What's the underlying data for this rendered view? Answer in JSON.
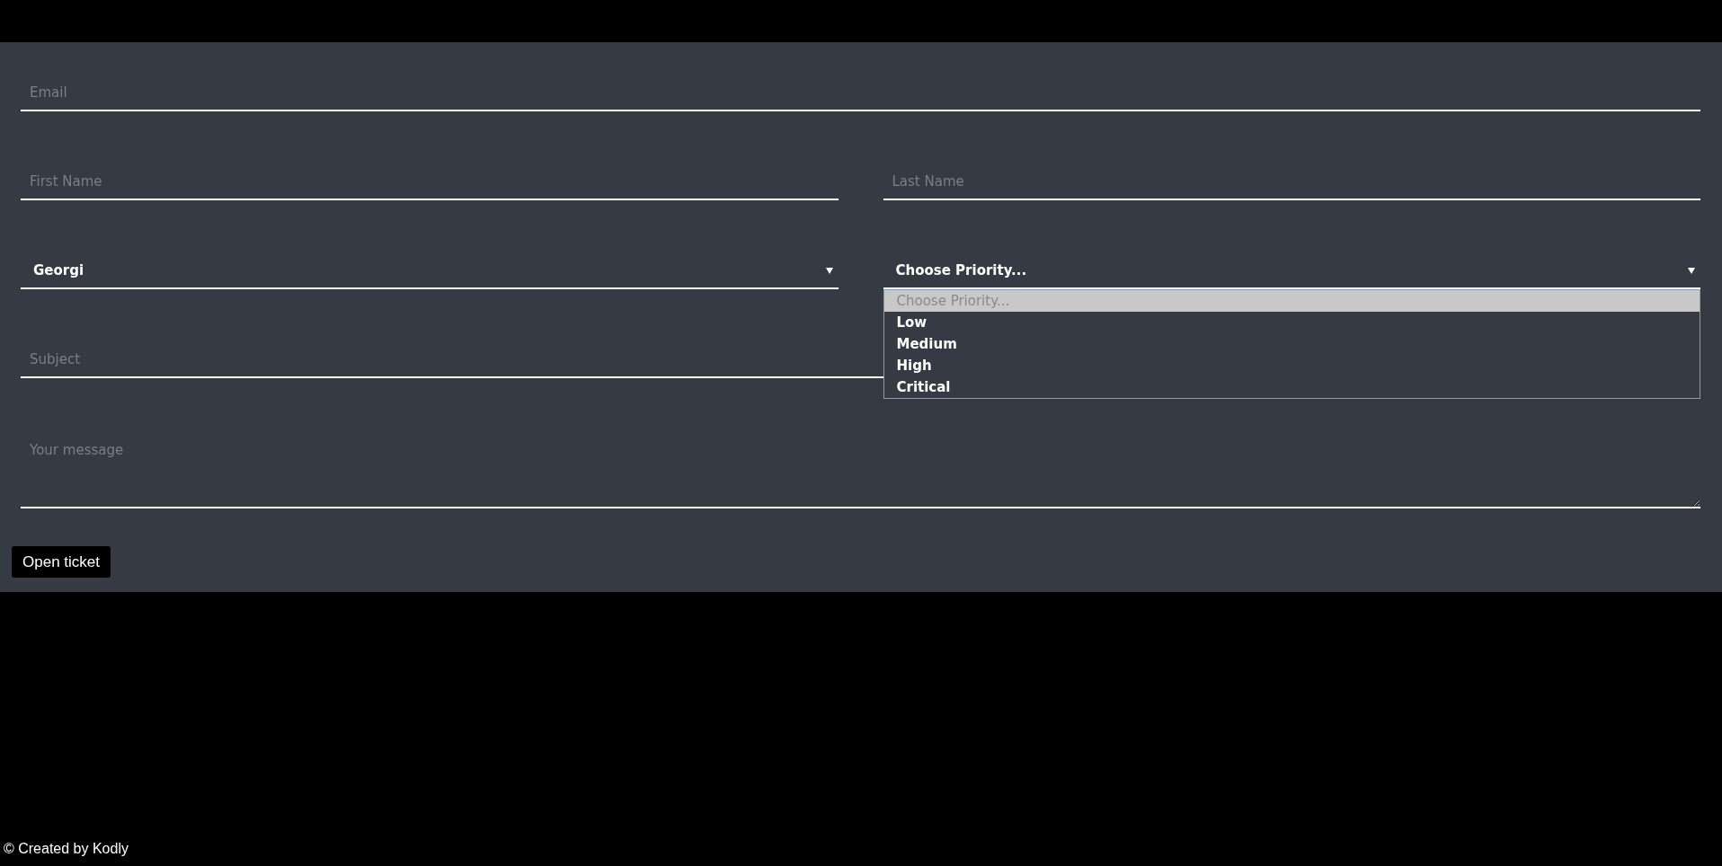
{
  "email": {
    "placeholder": "Email"
  },
  "first_name": {
    "placeholder": "First Name"
  },
  "last_name": {
    "placeholder": "Last Name"
  },
  "selects": [
    {
      "value": "Georgi",
      "expanded": false
    },
    {
      "value": "Choose Priority...",
      "expanded": true,
      "options": [
        {
          "label": "Choose Priority...",
          "selected": true,
          "disabled": true
        },
        {
          "label": "Low",
          "selected": false,
          "disabled": false
        },
        {
          "label": "Medium",
          "selected": false,
          "disabled": false
        },
        {
          "label": "High",
          "selected": false,
          "disabled": false
        },
        {
          "label": "Critical",
          "selected": false,
          "disabled": false
        }
      ]
    }
  ],
  "subject": {
    "placeholder": "Subject"
  },
  "message": {
    "placeholder": "Your message"
  },
  "submit_button": "Open ticket",
  "footer": "© Created by Kodly"
}
